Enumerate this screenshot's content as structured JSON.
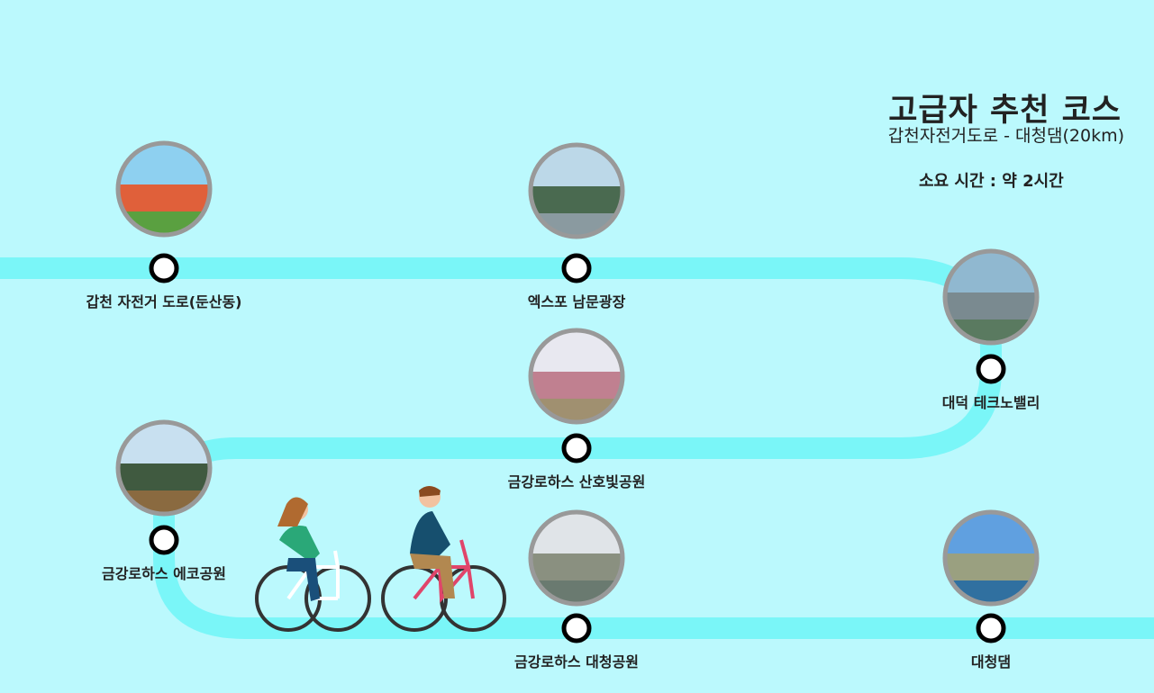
{
  "header": {
    "title": "고급자 추천 코스",
    "subtitle": "갑천자전거도로 - 대청댐(20km)",
    "duration": "소요 시간 : 약 2시간"
  },
  "colors": {
    "background": "#bbf9fd",
    "route": "#7af6f8",
    "node_fill": "#ffffff",
    "node_stroke": "#000000",
    "photo_ring": "#999999"
  },
  "stops": [
    {
      "label": "갑천 자전거 도로(둔산동)",
      "photo": "cycle-path-photo"
    },
    {
      "label": "엑스포 남문광장",
      "photo": "expo-bridge-photo"
    },
    {
      "label": "대덕 테크노밸리",
      "photo": "aerial-city-photo"
    },
    {
      "label": "금강로하스 산호빛공원",
      "photo": "pink-muhly-field-photo"
    },
    {
      "label": "금강로하스 에코공원",
      "photo": "eco-park-photo"
    },
    {
      "label": "금강로하스 대청공원",
      "photo": "river-trees-photo"
    },
    {
      "label": "대청댐",
      "photo": "dam-photo"
    }
  ]
}
